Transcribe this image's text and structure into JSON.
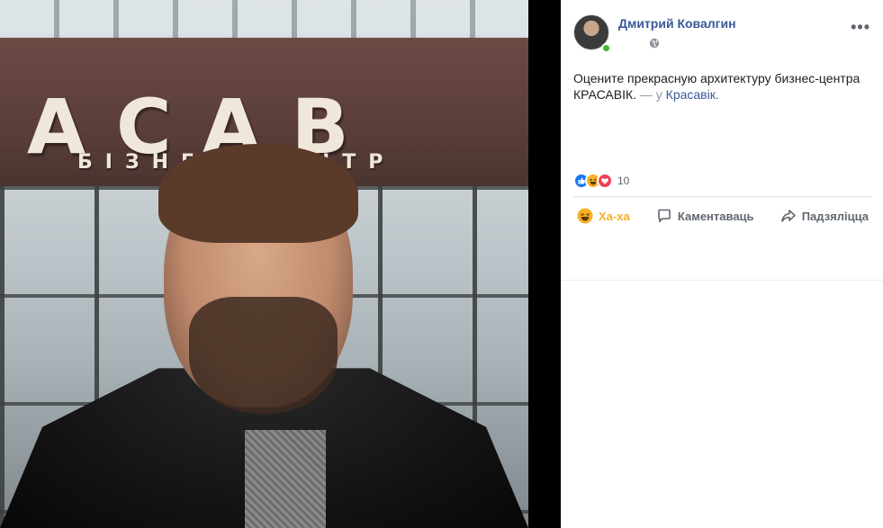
{
  "post": {
    "author": "Дмитрий Ковалгин",
    "text": "Оцените прекрасную архитектуру бизнес-центра КРАСАВІК.",
    "with_prefix": "— у",
    "place": "Красавік.",
    "reaction_count": "10",
    "reactions": [
      "like-icon",
      "haha-icon",
      "love-icon"
    ]
  },
  "photo": {
    "sign_big": "ACAB",
    "sign_small": "БІЗНЕС-ЦЭНТР"
  },
  "actions": {
    "haha_label": "Ха-ха",
    "comment_label": "Каментаваць",
    "share_label": "Падзяліцца"
  },
  "colors": {
    "link": "#385898",
    "haha": "#f7b125",
    "like": "#1877f2",
    "love": "#f33e58",
    "online": "#42b72a"
  }
}
